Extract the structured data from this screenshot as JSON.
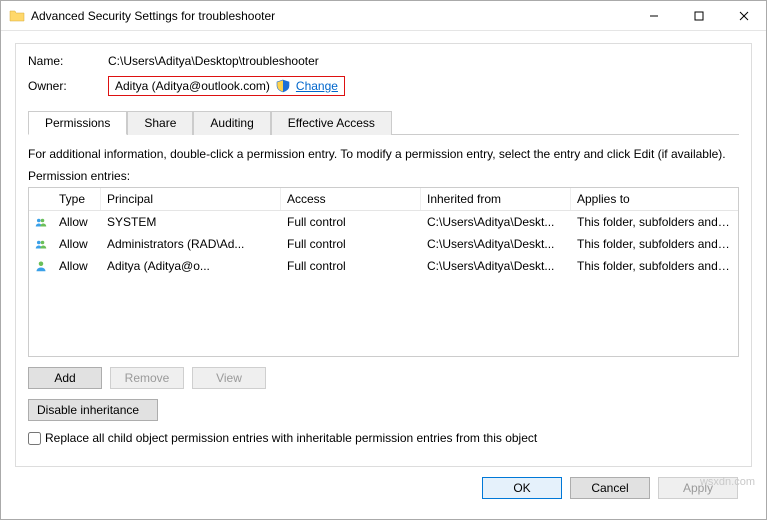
{
  "window": {
    "title": "Advanced Security Settings for troubleshooter"
  },
  "header": {
    "name_label": "Name:",
    "name_value": "C:\\Users\\Aditya\\Desktop\\troubleshooter",
    "owner_label": "Owner:",
    "owner_value": "Aditya (Aditya@outlook.com)",
    "change_label": "Change"
  },
  "tabs": {
    "permissions": "Permissions",
    "share": "Share",
    "auditing": "Auditing",
    "effective": "Effective Access"
  },
  "info_text": "For additional information, double-click a permission entry. To modify a permission entry, select the entry and click Edit (if available).",
  "entries_label": "Permission entries:",
  "columns": {
    "type": "Type",
    "principal": "Principal",
    "access": "Access",
    "inherited": "Inherited from",
    "applies": "Applies to"
  },
  "rows": [
    {
      "type": "Allow",
      "principal": "SYSTEM",
      "access": "Full control",
      "inherited": "C:\\Users\\Aditya\\Deskt...",
      "applies": "This folder, subfolders and files",
      "icon": "group"
    },
    {
      "type": "Allow",
      "principal": "Administrators (RAD\\Ad...",
      "access": "Full control",
      "inherited": "C:\\Users\\Aditya\\Deskt...",
      "applies": "This folder, subfolders and files",
      "icon": "group"
    },
    {
      "type": "Allow",
      "principal": "Aditya (Aditya@o...",
      "access": "Full control",
      "inherited": "C:\\Users\\Aditya\\Deskt...",
      "applies": "This folder, subfolders and files",
      "icon": "user"
    }
  ],
  "buttons": {
    "add": "Add",
    "remove": "Remove",
    "view": "View",
    "disable_inheritance": "Disable inheritance",
    "ok": "OK",
    "cancel": "Cancel",
    "apply": "Apply"
  },
  "checkbox_label": "Replace all child object permission entries with inheritable permission entries from this object",
  "watermark": "wsxdn.com"
}
